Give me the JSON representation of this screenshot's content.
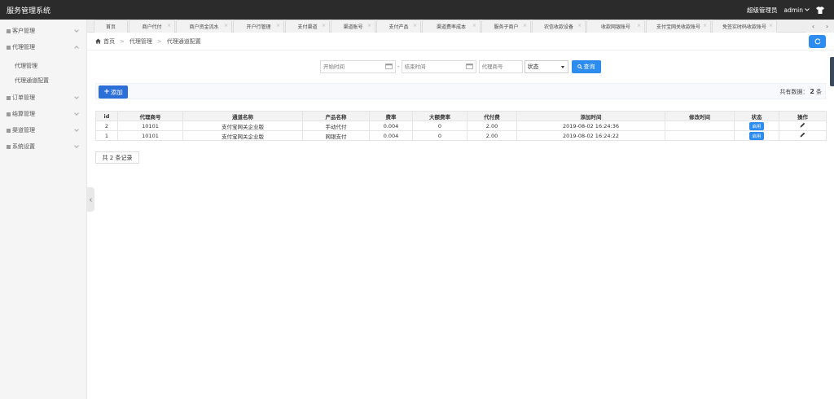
{
  "app": {
    "title": "服务管理系统"
  },
  "header": {
    "role": "超级管理员",
    "user": "admin"
  },
  "sidebar": {
    "items": [
      {
        "label": "客户管理",
        "expanded": false
      },
      {
        "label": "代理管理",
        "expanded": true,
        "children": [
          "代理管理",
          "代理通道配置"
        ]
      },
      {
        "label": "订单管理",
        "expanded": false
      },
      {
        "label": "结算管理",
        "expanded": false
      },
      {
        "label": "渠道管理",
        "expanded": false
      },
      {
        "label": "系统设置",
        "expanded": false
      }
    ]
  },
  "tabs": [
    {
      "label": "首页",
      "closable": false
    },
    {
      "label": "商户代付",
      "closable": true
    },
    {
      "label": "商户资金流水",
      "closable": true
    },
    {
      "label": "开户行管理",
      "closable": true
    },
    {
      "label": "支付渠道",
      "closable": true
    },
    {
      "label": "渠道账号",
      "closable": true
    },
    {
      "label": "支付产品",
      "closable": true
    },
    {
      "label": "渠道费率成本",
      "closable": true
    },
    {
      "label": "服务子商户",
      "closable": true
    },
    {
      "label": "农信收款设备",
      "closable": true
    },
    {
      "label": "收款网银账号",
      "closable": true
    },
    {
      "label": "支付宝网关收款账号",
      "closable": true
    },
    {
      "label": "免签实时码收款账号",
      "closable": true
    }
  ],
  "breadcrumb": {
    "home": "首页",
    "level1": "代理管理",
    "level2": "代理通道配置"
  },
  "search": {
    "start_placeholder": "开始时间",
    "end_placeholder": "结束时间",
    "agent_placeholder": "代理商号",
    "status_value": "状态",
    "query_label": "查询"
  },
  "toolbar": {
    "add_label": "添加",
    "total_prefix": "共有数据：",
    "total_count": "2",
    "total_suffix": "条"
  },
  "table": {
    "columns": [
      "id",
      "代理商号",
      "通道名称",
      "产品名称",
      "费率",
      "大额费率",
      "代付费",
      "添加时间",
      "修改时间",
      "状态",
      "操作"
    ],
    "rows": [
      {
        "id": "2",
        "agent": "10101",
        "channel": "支付宝网关企业版",
        "product": "手动代付",
        "rate": "0.004",
        "big_rate": "0",
        "fee": "2.00",
        "added": "2019-08-02 16:24:36",
        "modified": "",
        "status": "启用"
      },
      {
        "id": "1",
        "agent": "10101",
        "channel": "支付宝网关企业版",
        "product": "网银支付",
        "rate": "0.004",
        "big_rate": "0",
        "fee": "2.00",
        "added": "2019-08-02 16:24:22",
        "modified": "",
        "status": "启用"
      }
    ]
  },
  "footer": {
    "records": "共 2 条记录"
  },
  "colors": {
    "topbar": "#2b2b2b",
    "primary": "#2d8cf0",
    "add_button": "#2d6fd8"
  }
}
